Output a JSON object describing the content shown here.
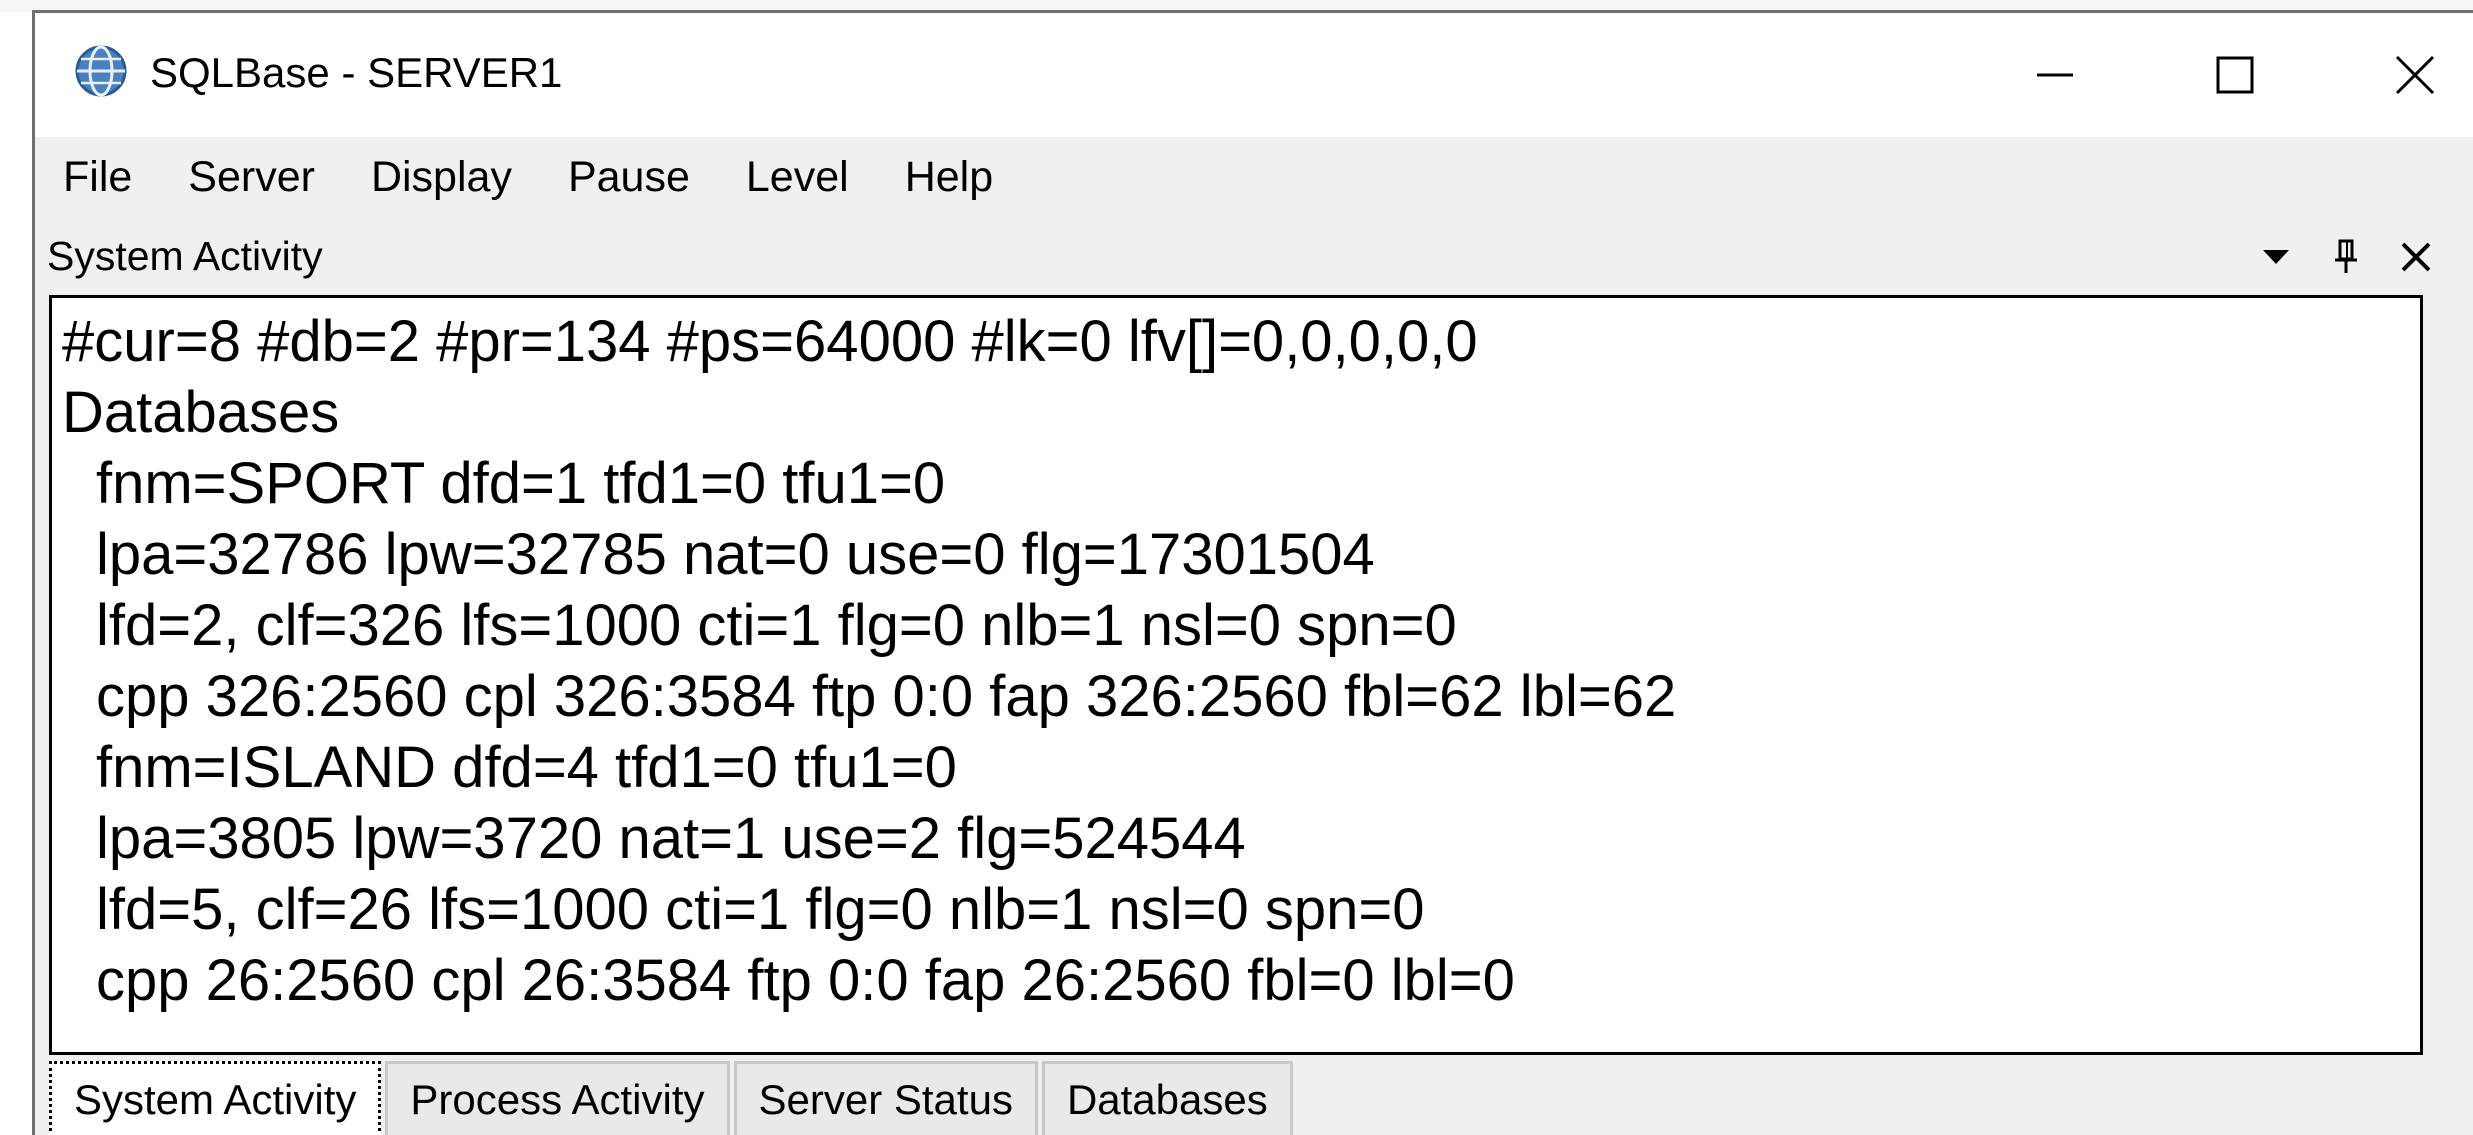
{
  "window": {
    "title": "SQLBase - SERVER1",
    "icon": "database-globe-icon"
  },
  "controls": {
    "minimize_icon": "minimize-icon",
    "maximize_icon": "maximize-icon",
    "close_icon": "close-icon"
  },
  "menu": {
    "items": [
      "File",
      "Server",
      "Display",
      "Pause",
      "Level",
      "Help"
    ]
  },
  "panel": {
    "title": "System Activity",
    "dropdown_icon": "dropdown-arrow-icon",
    "pin_icon": "pin-icon",
    "close_icon": "close-icon"
  },
  "activity": {
    "lines": [
      "#cur=8 #db=2 #pr=134 #ps=64000 #lk=0 lfv[]=0,0,0,0,0",
      "Databases",
      "fnm=SPORT dfd=1 tfd1=0 tfu1=0",
      "lpa=32786 lpw=32785 nat=0 use=0 flg=17301504",
      "lfd=2, clf=326 lfs=1000 cti=1 flg=0 nlb=1 nsl=0 spn=0",
      "cpp 326:2560 cpl 326:3584 ftp 0:0 fap 326:2560 fbl=62 lbl=62",
      "fnm=ISLAND dfd=4 tfd1=0 tfu1=0",
      "lpa=3805 lpw=3720 nat=1 use=2 flg=524544",
      "lfd=5, clf=26 lfs=1000 cti=1 flg=0 nlb=1 nsl=0 spn=0",
      "cpp 26:2560 cpl 26:3584 ftp 0:0 fap 26:2560 fbl=0 lbl=0"
    ]
  },
  "tabs": [
    {
      "label": "System Activity",
      "active": true
    },
    {
      "label": "Process Activity",
      "active": false
    },
    {
      "label": "Server Status",
      "active": false
    },
    {
      "label": "Databases",
      "active": false
    }
  ],
  "colors": {
    "titlebar_bg": "#ffffff",
    "window_bg": "#f0f0f0",
    "text": "#000000"
  }
}
